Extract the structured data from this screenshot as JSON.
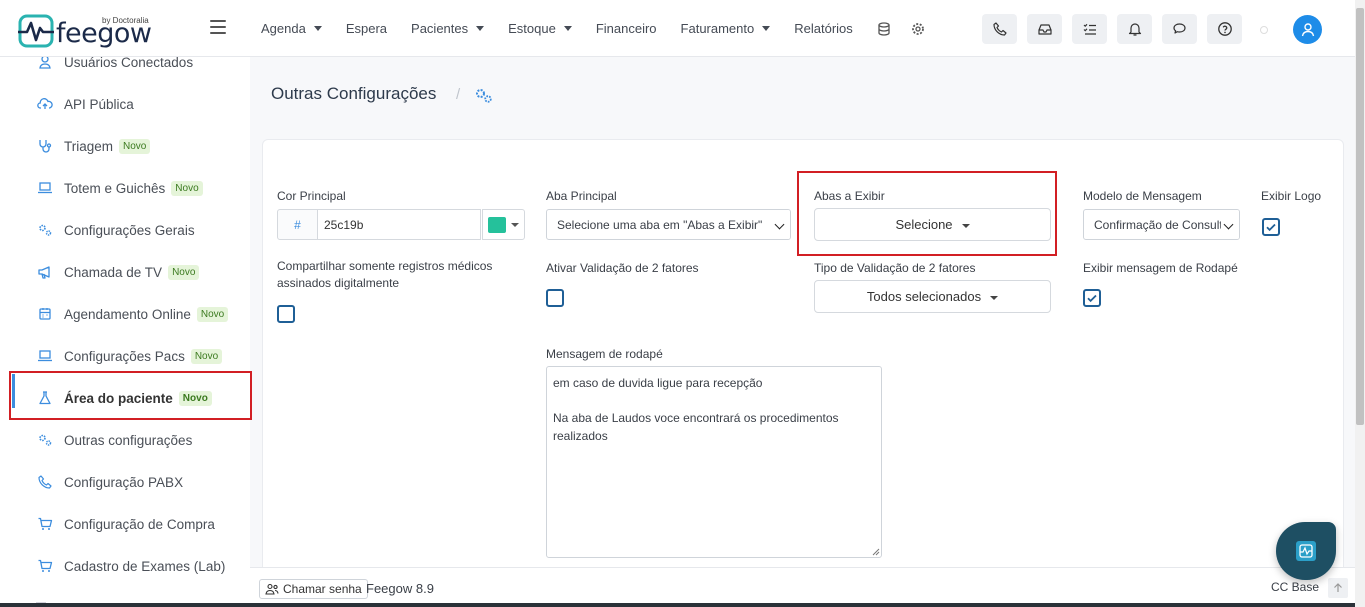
{
  "app": {
    "logo_word": "feegow",
    "logo_by": "by Doctoralia"
  },
  "nav": {
    "items": [
      {
        "label": "Agenda",
        "caret": true
      },
      {
        "label": "Espera",
        "caret": false
      },
      {
        "label": "Pacientes",
        "caret": true
      },
      {
        "label": "Estoque",
        "caret": true
      },
      {
        "label": "Financeiro",
        "caret": false
      },
      {
        "label": "Faturamento",
        "caret": true
      },
      {
        "label": "Relatórios",
        "caret": false
      }
    ],
    "icons": [
      "database-icon",
      "gear-icon"
    ],
    "toolbar_buttons": [
      "phone-icon",
      "inbox-icon",
      "checklist-icon",
      "bell-icon",
      "chat-icon",
      "help-icon"
    ]
  },
  "sidebar": {
    "items": [
      {
        "label": "Usuários Conectados",
        "icon": "user-icon",
        "badge": ""
      },
      {
        "label": "API Pública",
        "icon": "cloud-upload-icon",
        "badge": ""
      },
      {
        "label": "Triagem",
        "icon": "stethoscope-icon",
        "badge": "Novo"
      },
      {
        "label": "Totem e Guichês",
        "icon": "laptop-icon",
        "badge": "Novo"
      },
      {
        "label": "Configurações Gerais",
        "icon": "gears-icon",
        "badge": ""
      },
      {
        "label": "Chamada de TV",
        "icon": "megaphone-icon",
        "badge": "Novo"
      },
      {
        "label": "Agendamento Online",
        "icon": "calendar-icon",
        "badge": "Novo"
      },
      {
        "label": "Configurações Pacs",
        "icon": "laptop-icon",
        "badge": "Novo"
      },
      {
        "label": "Área do paciente",
        "icon": "flask-icon",
        "badge": "Novo"
      },
      {
        "label": "Outras configurações",
        "icon": "gears-icon",
        "badge": ""
      },
      {
        "label": "Configuração PABX",
        "icon": "phone-icon",
        "badge": ""
      },
      {
        "label": "Configuração de Compra",
        "icon": "cart-icon",
        "badge": ""
      },
      {
        "label": "Cadastro de Exames (Lab)",
        "icon": "cart-icon",
        "badge": ""
      }
    ],
    "active_index": 8
  },
  "page": {
    "title": "Outras Configurações",
    "separator": "/"
  },
  "form": {
    "cor_principal": {
      "label": "Cor Principal",
      "prefix": "#",
      "value": "25c19b",
      "swatch_color": "#25c19b"
    },
    "aba_principal": {
      "label": "Aba Principal",
      "value": "Selecione uma aba em \"Abas a Exibir\""
    },
    "abas_exibir": {
      "label": "Abas a Exibir",
      "value": "Selecione"
    },
    "modelo_mensagem": {
      "label": "Modelo de Mensagem",
      "value": "Confirmação de Consulta"
    },
    "exibir_logo": {
      "label": "Exibir Logo",
      "checked": true
    },
    "compartilhar": {
      "label": "Compartilhar somente registros médicos assinados digitalmente",
      "checked": false
    },
    "validacao_2fa": {
      "label": "Ativar Validação de 2 fatores",
      "checked": false
    },
    "tipo_validacao": {
      "label": "Tipo de Validação de 2 fatores",
      "value": "Todos selecionados"
    },
    "exibir_rodape": {
      "label": "Exibir mensagem de Rodapé",
      "checked": true
    },
    "mensagem_rodape": {
      "label": "Mensagem de rodapé",
      "value": "em caso de duvida ligue para recepção\n\nNa aba de Laudos voce encontrará os procedimentos realizados"
    }
  },
  "footer": {
    "chamar_senha": "Chamar senha",
    "version": "Feegow 8.9",
    "base": "CC Base"
  },
  "colors": {
    "accent": "#3c8dde",
    "highlight": "#d21f24",
    "badge_bg": "#e5f4d9",
    "badge_text": "#3b7a1f",
    "fab": "#1e4f63"
  }
}
